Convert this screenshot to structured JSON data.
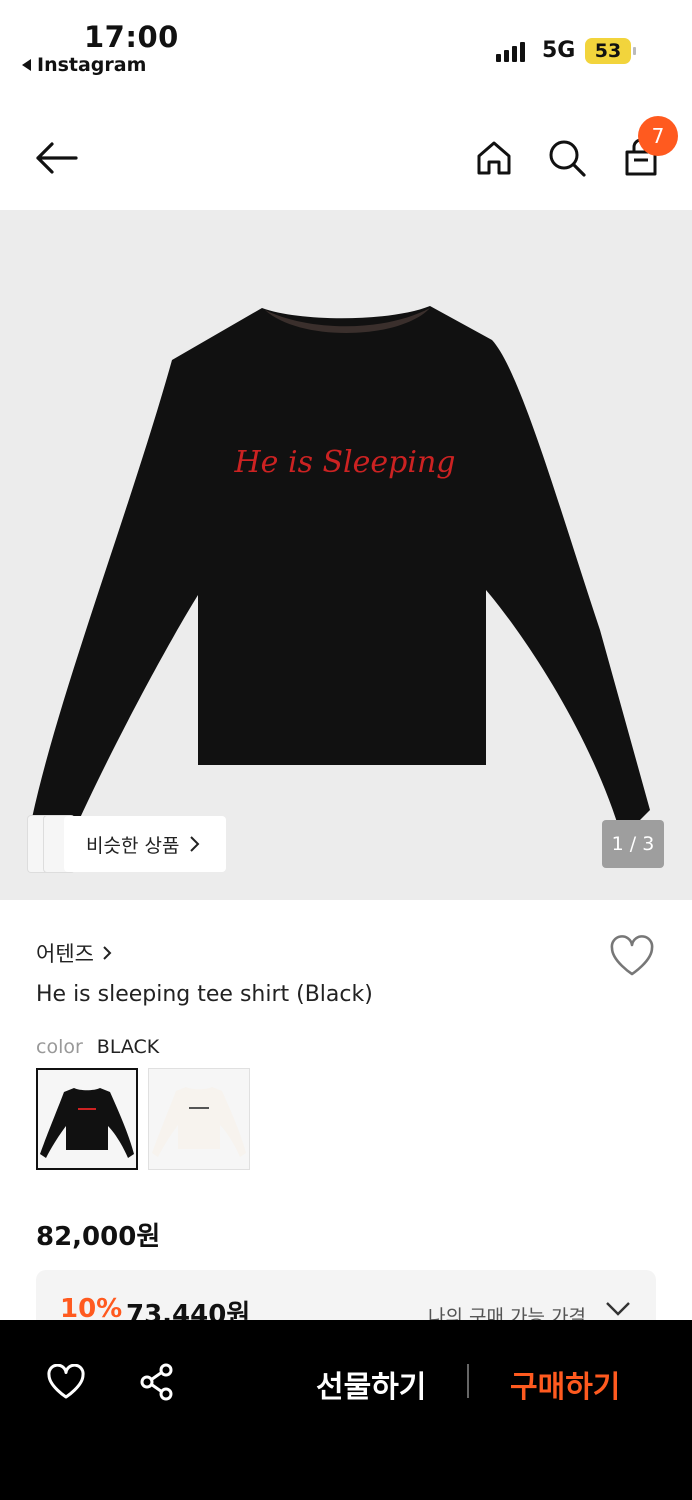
{
  "status_bar": {
    "time": "17:00",
    "back_app": "Instagram",
    "network": "5G",
    "battery": "53"
  },
  "header": {
    "cart_count": "7",
    "icons": [
      "back-arrow-icon",
      "home-icon",
      "search-icon",
      "cart-icon"
    ]
  },
  "hero": {
    "image": "black long-sleeve tee",
    "embroidery_text": "He is Sleeping",
    "similar_label": "비슷한 상품",
    "pager": "1 / 3"
  },
  "product": {
    "brand": "어텐즈",
    "name": "He is sleeping tee shirt (Black)",
    "color_key": "color",
    "color_value": "BLACK",
    "price": "82,000원",
    "discount_percent": "10%",
    "discount_price": "73,440원",
    "my_price_label": "나의 구매 가능 가격"
  },
  "bottom_bar": {
    "gift_label": "선물하기",
    "buy_label": "구매하기"
  },
  "colors": {
    "accent": "#ff5a1f",
    "battery": "#f2d43c",
    "hero_bg": "#ececec"
  }
}
